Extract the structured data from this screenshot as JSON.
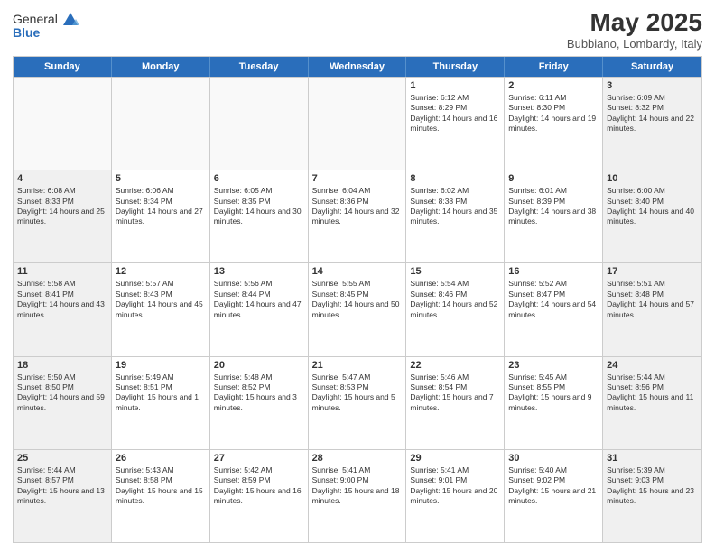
{
  "logo": {
    "general": "General",
    "blue": "Blue"
  },
  "title": "May 2025",
  "location": "Bubbiano, Lombardy, Italy",
  "days": [
    "Sunday",
    "Monday",
    "Tuesday",
    "Wednesday",
    "Thursday",
    "Friday",
    "Saturday"
  ],
  "rows": [
    [
      {
        "day": "",
        "info": ""
      },
      {
        "day": "",
        "info": ""
      },
      {
        "day": "",
        "info": ""
      },
      {
        "day": "",
        "info": ""
      },
      {
        "day": "1",
        "info": "Sunrise: 6:12 AM\nSunset: 8:29 PM\nDaylight: 14 hours and 16 minutes."
      },
      {
        "day": "2",
        "info": "Sunrise: 6:11 AM\nSunset: 8:30 PM\nDaylight: 14 hours and 19 minutes."
      },
      {
        "day": "3",
        "info": "Sunrise: 6:09 AM\nSunset: 8:32 PM\nDaylight: 14 hours and 22 minutes."
      }
    ],
    [
      {
        "day": "4",
        "info": "Sunrise: 6:08 AM\nSunset: 8:33 PM\nDaylight: 14 hours and 25 minutes."
      },
      {
        "day": "5",
        "info": "Sunrise: 6:06 AM\nSunset: 8:34 PM\nDaylight: 14 hours and 27 minutes."
      },
      {
        "day": "6",
        "info": "Sunrise: 6:05 AM\nSunset: 8:35 PM\nDaylight: 14 hours and 30 minutes."
      },
      {
        "day": "7",
        "info": "Sunrise: 6:04 AM\nSunset: 8:36 PM\nDaylight: 14 hours and 32 minutes."
      },
      {
        "day": "8",
        "info": "Sunrise: 6:02 AM\nSunset: 8:38 PM\nDaylight: 14 hours and 35 minutes."
      },
      {
        "day": "9",
        "info": "Sunrise: 6:01 AM\nSunset: 8:39 PM\nDaylight: 14 hours and 38 minutes."
      },
      {
        "day": "10",
        "info": "Sunrise: 6:00 AM\nSunset: 8:40 PM\nDaylight: 14 hours and 40 minutes."
      }
    ],
    [
      {
        "day": "11",
        "info": "Sunrise: 5:58 AM\nSunset: 8:41 PM\nDaylight: 14 hours and 43 minutes."
      },
      {
        "day": "12",
        "info": "Sunrise: 5:57 AM\nSunset: 8:43 PM\nDaylight: 14 hours and 45 minutes."
      },
      {
        "day": "13",
        "info": "Sunrise: 5:56 AM\nSunset: 8:44 PM\nDaylight: 14 hours and 47 minutes."
      },
      {
        "day": "14",
        "info": "Sunrise: 5:55 AM\nSunset: 8:45 PM\nDaylight: 14 hours and 50 minutes."
      },
      {
        "day": "15",
        "info": "Sunrise: 5:54 AM\nSunset: 8:46 PM\nDaylight: 14 hours and 52 minutes."
      },
      {
        "day": "16",
        "info": "Sunrise: 5:52 AM\nSunset: 8:47 PM\nDaylight: 14 hours and 54 minutes."
      },
      {
        "day": "17",
        "info": "Sunrise: 5:51 AM\nSunset: 8:48 PM\nDaylight: 14 hours and 57 minutes."
      }
    ],
    [
      {
        "day": "18",
        "info": "Sunrise: 5:50 AM\nSunset: 8:50 PM\nDaylight: 14 hours and 59 minutes."
      },
      {
        "day": "19",
        "info": "Sunrise: 5:49 AM\nSunset: 8:51 PM\nDaylight: 15 hours and 1 minute."
      },
      {
        "day": "20",
        "info": "Sunrise: 5:48 AM\nSunset: 8:52 PM\nDaylight: 15 hours and 3 minutes."
      },
      {
        "day": "21",
        "info": "Sunrise: 5:47 AM\nSunset: 8:53 PM\nDaylight: 15 hours and 5 minutes."
      },
      {
        "day": "22",
        "info": "Sunrise: 5:46 AM\nSunset: 8:54 PM\nDaylight: 15 hours and 7 minutes."
      },
      {
        "day": "23",
        "info": "Sunrise: 5:45 AM\nSunset: 8:55 PM\nDaylight: 15 hours and 9 minutes."
      },
      {
        "day": "24",
        "info": "Sunrise: 5:44 AM\nSunset: 8:56 PM\nDaylight: 15 hours and 11 minutes."
      }
    ],
    [
      {
        "day": "25",
        "info": "Sunrise: 5:44 AM\nSunset: 8:57 PM\nDaylight: 15 hours and 13 minutes."
      },
      {
        "day": "26",
        "info": "Sunrise: 5:43 AM\nSunset: 8:58 PM\nDaylight: 15 hours and 15 minutes."
      },
      {
        "day": "27",
        "info": "Sunrise: 5:42 AM\nSunset: 8:59 PM\nDaylight: 15 hours and 16 minutes."
      },
      {
        "day": "28",
        "info": "Sunrise: 5:41 AM\nSunset: 9:00 PM\nDaylight: 15 hours and 18 minutes."
      },
      {
        "day": "29",
        "info": "Sunrise: 5:41 AM\nSunset: 9:01 PM\nDaylight: 15 hours and 20 minutes."
      },
      {
        "day": "30",
        "info": "Sunrise: 5:40 AM\nSunset: 9:02 PM\nDaylight: 15 hours and 21 minutes."
      },
      {
        "day": "31",
        "info": "Sunrise: 5:39 AM\nSunset: 9:03 PM\nDaylight: 15 hours and 23 minutes."
      }
    ]
  ]
}
